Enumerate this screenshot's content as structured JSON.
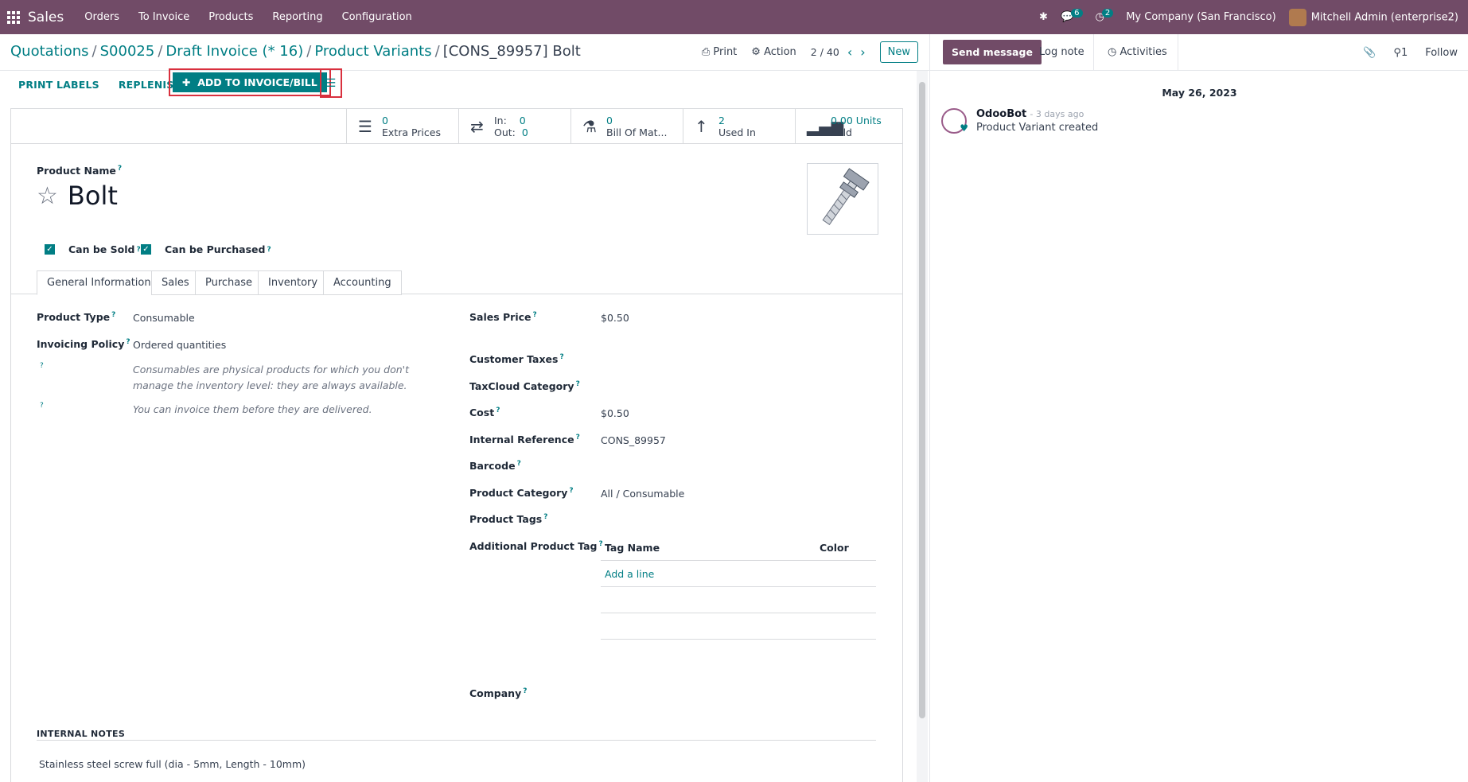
{
  "navbar": {
    "brand": "Sales",
    "menu": [
      "Orders",
      "To Invoice",
      "Products",
      "Reporting",
      "Configuration"
    ],
    "messages_count": "6",
    "activities_count": "2",
    "company": "My Company (San Francisco)",
    "user": "Mitchell Admin (enterprise2)"
  },
  "breadcrumb": [
    "Quotations",
    "S00025",
    "Draft Invoice (* 16)",
    "Product Variants"
  ],
  "breadcrumb_current": "[CONS_89957] Bolt",
  "control": {
    "print": "Print",
    "action": "Action",
    "pager": "2 / 40",
    "new": "New"
  },
  "actions": {
    "print_labels": "PRINT LABELS",
    "replenish": "REPLENISH",
    "add_invoice": "ADD TO INVOICE/BILL"
  },
  "stats": [
    {
      "value": "0",
      "label": "Extra Prices"
    },
    {
      "in_label": "In:",
      "in_value": "0",
      "out_label": "Out:",
      "out_value": "0"
    },
    {
      "value": "0",
      "label": "Bill Of Mat..."
    },
    {
      "value": "2",
      "label": "Used In"
    },
    {
      "value": "0.00 Units",
      "label": "Sold"
    }
  ],
  "product": {
    "name_label": "Product Name",
    "name": "Bolt",
    "can_be_sold": "Can be Sold",
    "can_be_purchased": "Can be Purchased"
  },
  "tabs": [
    "General Information",
    "Sales",
    "Purchase",
    "Inventory",
    "Accounting"
  ],
  "left_fields": {
    "product_type_label": "Product Type",
    "product_type": "Consumable",
    "invoicing_policy_label": "Invoicing Policy",
    "invoicing_policy": "Ordered quantities",
    "help1": "Consumables are physical products for which you don't manage the inventory level: they are always available.",
    "help2": "You can invoice them before they are delivered."
  },
  "right_fields": {
    "sales_price_label": "Sales Price",
    "sales_price": "$0.50",
    "customer_taxes_label": "Customer Taxes",
    "taxcloud_label": "TaxCloud Category",
    "cost_label": "Cost",
    "cost": "$0.50",
    "internal_ref_label": "Internal Reference",
    "internal_ref": "CONS_89957",
    "barcode_label": "Barcode",
    "category_label": "Product Category",
    "category": "All / Consumable",
    "tags_label": "Product Tags",
    "add_tag_label": "Additional Product Tag",
    "company_label": "Company"
  },
  "tag_table": {
    "col_name": "Tag Name",
    "col_color": "Color",
    "add_line": "Add a line"
  },
  "notes": {
    "label": "INTERNAL NOTES",
    "value": "Stainless steel screw full (dia - 5mm, Length - 10mm)"
  },
  "chatter": {
    "send_message": "Send message",
    "log_note": "Log note",
    "activities": "Activities",
    "followers": "1",
    "follow": "Follow",
    "date": "May 26, 2023",
    "author": "OdooBot",
    "time": "- 3 days ago",
    "body": "Product Variant created"
  },
  "colors": {
    "brand": "#714B67",
    "accent": "#017E84",
    "highlight": "#d9303e"
  }
}
